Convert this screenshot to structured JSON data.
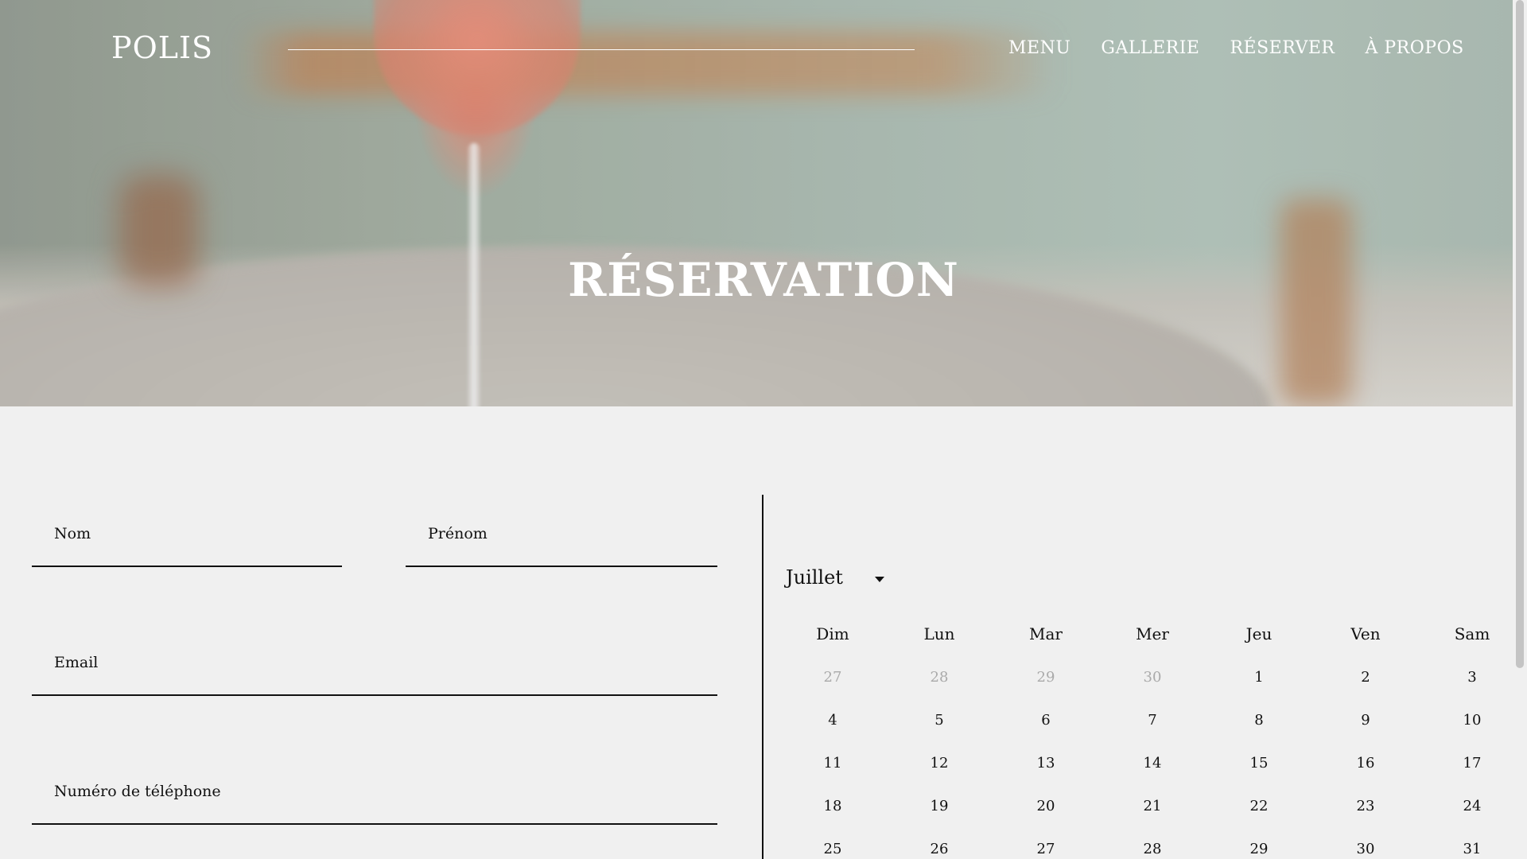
{
  "brand": {
    "logo": "POLIS"
  },
  "nav": {
    "items": [
      {
        "label": "MENU"
      },
      {
        "label": "GALLERIE"
      },
      {
        "label": "RÉSERVER"
      },
      {
        "label": "À PROPOS"
      }
    ]
  },
  "hero": {
    "title": "RÉSERVATION"
  },
  "form": {
    "nom_label": "Nom",
    "prenom_label": "Prénom",
    "email_label": "Email",
    "phone_label": "Numéro de téléphone"
  },
  "calendar": {
    "month": "Juillet",
    "weekdays": [
      "Dim",
      "Lun",
      "Mar",
      "Mer",
      "Jeu",
      "Ven",
      "Sam"
    ],
    "weeks": [
      [
        {
          "d": "27",
          "muted": true
        },
        {
          "d": "28",
          "muted": true
        },
        {
          "d": "29",
          "muted": true
        },
        {
          "d": "30",
          "muted": true
        },
        {
          "d": "1"
        },
        {
          "d": "2"
        },
        {
          "d": "3"
        }
      ],
      [
        {
          "d": "4"
        },
        {
          "d": "5"
        },
        {
          "d": "6"
        },
        {
          "d": "7"
        },
        {
          "d": "8"
        },
        {
          "d": "9"
        },
        {
          "d": "10"
        }
      ],
      [
        {
          "d": "11"
        },
        {
          "d": "12"
        },
        {
          "d": "13"
        },
        {
          "d": "14"
        },
        {
          "d": "15"
        },
        {
          "d": "16"
        },
        {
          "d": "17"
        }
      ],
      [
        {
          "d": "18"
        },
        {
          "d": "19"
        },
        {
          "d": "20"
        },
        {
          "d": "21"
        },
        {
          "d": "22"
        },
        {
          "d": "23"
        },
        {
          "d": "24"
        }
      ],
      [
        {
          "d": "25"
        },
        {
          "d": "26"
        },
        {
          "d": "27"
        },
        {
          "d": "28"
        },
        {
          "d": "29"
        },
        {
          "d": "30"
        },
        {
          "d": "31"
        }
      ]
    ]
  },
  "colors": {
    "background": "#f0f0f0",
    "text": "#111111",
    "muted_day": "#aaaaaa",
    "hero_text": "#ffffff"
  }
}
